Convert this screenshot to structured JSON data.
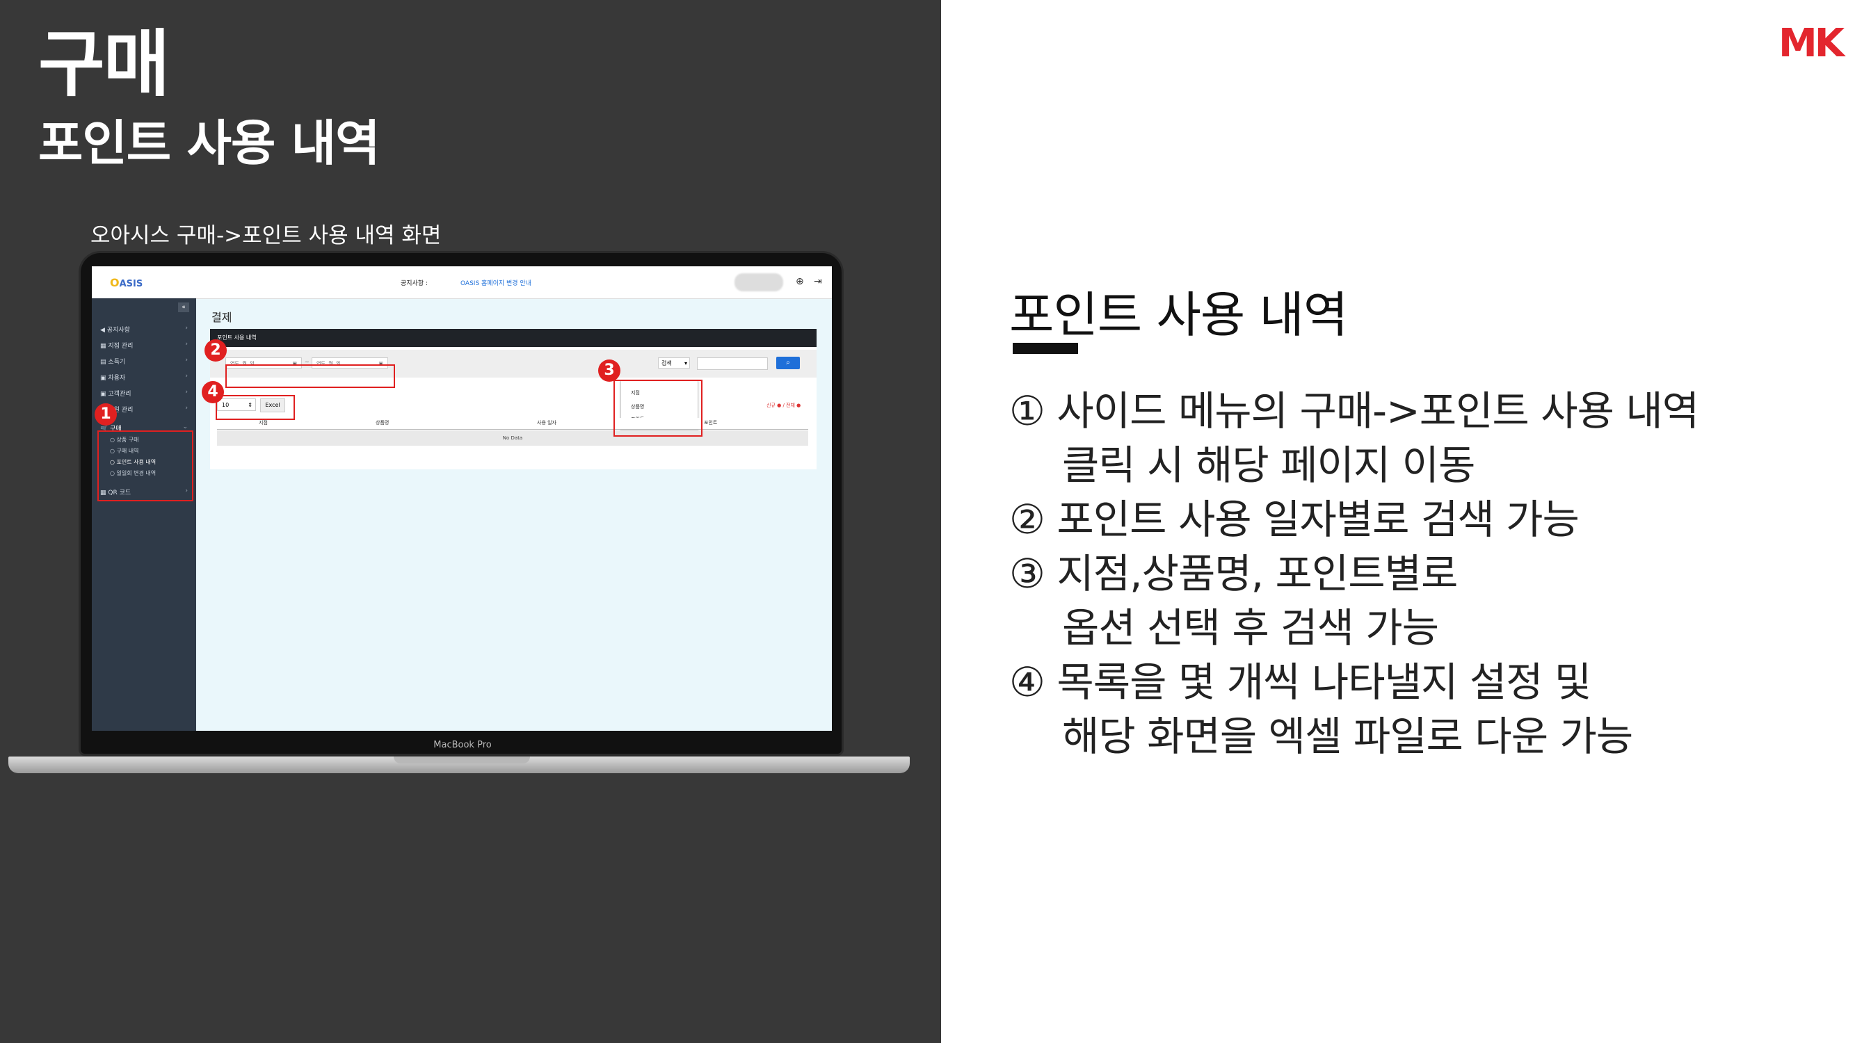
{
  "slide": {
    "title": "구매",
    "subtitle": "포인트 사용 내역",
    "caption": "오아시스 구매->포인트 사용 내역 화면",
    "logo": "MK"
  },
  "laptop": {
    "label": "MacBook Pro"
  },
  "app": {
    "logo": "ASIS",
    "logo_mark": "O",
    "notice_label": "공지사항 :",
    "notice_link": "OASIS 홈페이지 변경 안내",
    "sidebar": {
      "collapse": "«",
      "items": [
        "공지사항",
        "지점 관리",
        "소득기",
        "차용자",
        "고객관리",
        "회원 관리",
        "구매",
        "QR 코드"
      ],
      "sub_items": [
        "상품 구매",
        "구매 내역",
        "포인트 사용 내역",
        "일일회 변경 내역"
      ]
    },
    "page_title": "결제",
    "panel_title": "포인트 사용 내역",
    "date_from_placeholder": "연도. 월. 일.",
    "date_to_placeholder": "연도. 월. 일.",
    "date_sep": "~",
    "search_select": "검색",
    "search_options": [
      "지점",
      "상품명",
      "포인트"
    ],
    "search_icon": "search-icon",
    "page_size": "10",
    "excel_button": "Excel",
    "legend": "신규 ● / 전체 ●",
    "columns": [
      "지점",
      "상품명",
      "사용 일자",
      "포인트"
    ],
    "empty_text": "No Data"
  },
  "badges": [
    "1",
    "2",
    "3",
    "4"
  ],
  "description": {
    "heading": "포인트 사용 내역",
    "lines": [
      "① 사이드 메뉴의 구매->포인트 사용 내역",
      "클릭 시 해당 페이지 이동",
      "② 포인트 사용 일자별로 검색 가능",
      "③ 지점,상품명, 포인트별로",
      "옵션 선택 후 검색 가능",
      "④ 목록을 몇 개씩 나타낼지 설정 및",
      "해당 화면을 엑셀 파일로 다운 가능"
    ]
  },
  "colors": {
    "accent_red": "#e02020",
    "logo_red": "#e3262e",
    "dark_bg": "#383838",
    "link_blue": "#1e6fd9"
  }
}
